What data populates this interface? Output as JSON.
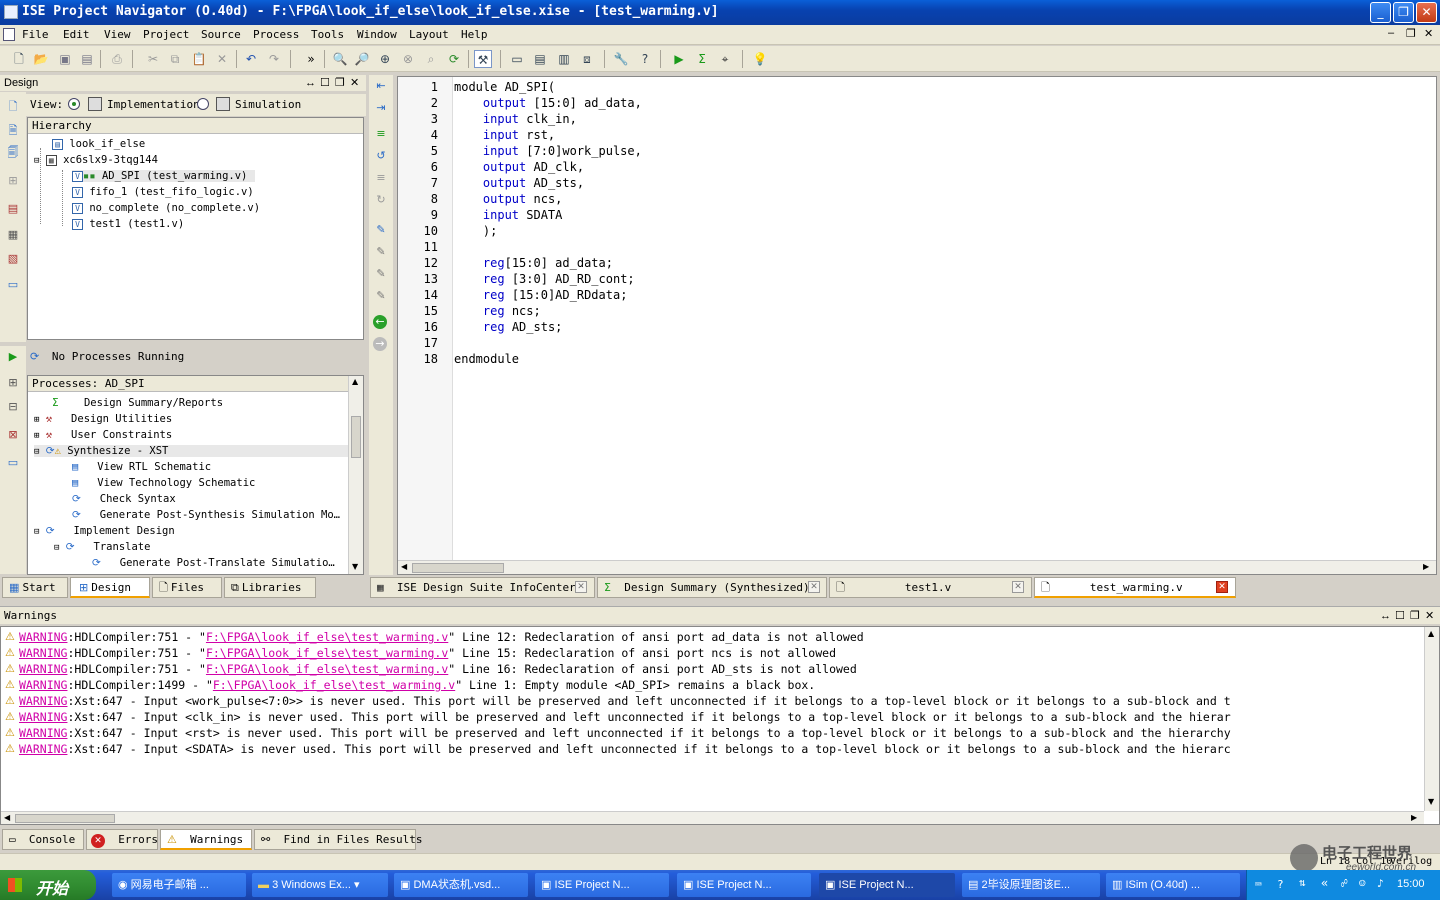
{
  "window": {
    "title": "ISE Project Navigator (O.40d) - F:\\FPGA\\look_if_else\\look_if_else.xise - [test_warming.v]"
  },
  "menu": [
    "File",
    "Edit",
    "View",
    "Project",
    "Source",
    "Process",
    "Tools",
    "Window",
    "Layout",
    "Help"
  ],
  "design_panel": {
    "title": "Design",
    "view_label": "View:",
    "impl_label": "Implementation",
    "sim_label": "Simulation",
    "hierarchy_header": "Hierarchy",
    "tree": [
      "look_if_else",
      "xc6slx9-3tqg144",
      "AD_SPI (test_warming.v)",
      "fifo_1 (test_fifo_logic.v)",
      "no_complete (no_complete.v)",
      "test1 (test1.v)"
    ],
    "status": "No Processes Running",
    "processes_header": "Processes: AD_SPI",
    "processes": [
      "Design Summary/Reports",
      "Design Utilities",
      "User Constraints",
      "Synthesize - XST",
      "View RTL Schematic",
      "View Technology Schematic",
      "Check Syntax",
      "Generate Post-Synthesis Simulation Mo…",
      "Implement Design",
      "Translate",
      "Generate Post-Translate Simulatio…"
    ],
    "bottom_tabs": [
      "Start",
      "Design",
      "Files",
      "Libraries"
    ]
  },
  "editor": {
    "lines": [
      {
        "n": "1",
        "pre": "module AD_SPI(",
        "kw": "",
        "post": ""
      },
      {
        "n": "2",
        "pre": "    ",
        "kw": "output",
        "post": " [15:0] ad_data,"
      },
      {
        "n": "3",
        "pre": "    ",
        "kw": "input",
        "post": " clk_in,"
      },
      {
        "n": "4",
        "pre": "    ",
        "kw": "input",
        "post": " rst,"
      },
      {
        "n": "5",
        "pre": "    ",
        "kw": "input",
        "post": " [7:0]work_pulse,"
      },
      {
        "n": "6",
        "pre": "    ",
        "kw": "output",
        "post": " AD_clk,"
      },
      {
        "n": "7",
        "pre": "    ",
        "kw": "output",
        "post": " AD_sts,"
      },
      {
        "n": "8",
        "pre": "    ",
        "kw": "output",
        "post": " ncs,"
      },
      {
        "n": "9",
        "pre": "    ",
        "kw": "input",
        "post": " SDATA"
      },
      {
        "n": "10",
        "pre": "    );",
        "kw": "",
        "post": ""
      },
      {
        "n": "11",
        "pre": "",
        "kw": "",
        "post": ""
      },
      {
        "n": "12",
        "pre": "    ",
        "kw": "reg",
        "post": "[15:0] ad_data;"
      },
      {
        "n": "13",
        "pre": "    ",
        "kw": "reg",
        "post": " [3:0] AD_RD_cont;"
      },
      {
        "n": "14",
        "pre": "    ",
        "kw": "reg",
        "post": " [15:0]AD_RDdata;"
      },
      {
        "n": "15",
        "pre": "    ",
        "kw": "reg",
        "post": " ncs;"
      },
      {
        "n": "16",
        "pre": "    ",
        "kw": "reg",
        "post": " AD_sts;"
      },
      {
        "n": "17",
        "pre": "",
        "kw": "",
        "post": ""
      },
      {
        "n": "18",
        "pre": "endmodule",
        "kw": "",
        "post": ""
      }
    ],
    "tabs": [
      "ISE Design Suite InfoCenter",
      "Design Summary (Synthesized)",
      "test1.v",
      "test_warming.v"
    ]
  },
  "warnings_panel": {
    "title": "Warnings",
    "lines": [
      {
        "tag": "WARNING",
        "a": ":HDLCompiler:751 - \"",
        "link": "F:\\FPGA\\look_if_else\\test_warming.v",
        "b": "\" Line 12: Redeclaration of ansi port ad_data is not allowed"
      },
      {
        "tag": "WARNING",
        "a": ":HDLCompiler:751 - \"",
        "link": "F:\\FPGA\\look_if_else\\test_warming.v",
        "b": "\" Line 15: Redeclaration of ansi port ncs is not allowed"
      },
      {
        "tag": "WARNING",
        "a": ":HDLCompiler:751 - \"",
        "link": "F:\\FPGA\\look_if_else\\test_warming.v",
        "b": "\" Line 16: Redeclaration of ansi port AD_sts is not allowed"
      },
      {
        "tag": "WARNING",
        "a": ":HDLCompiler:1499 - \"",
        "link": "F:\\FPGA\\look_if_else\\test_warming.v",
        "b": "\" Line 1: Empty module <AD_SPI> remains a black box."
      },
      {
        "tag": "WARNING",
        "a": ":Xst:647 - Input <work_pulse<7:0>> is never used. This port will be preserved and left unconnected if it belongs to a top-level block or it belongs to a sub-block and t",
        "link": "",
        "b": ""
      },
      {
        "tag": "WARNING",
        "a": ":Xst:647 - Input <clk_in> is never used. This port will be preserved and left unconnected if it belongs to a top-level block or it belongs to a sub-block and the hierar",
        "link": "",
        "b": ""
      },
      {
        "tag": "WARNING",
        "a": ":Xst:647 - Input <rst> is never used. This port will be preserved and left unconnected if it belongs to a top-level block or it belongs to a sub-block and the hierarchy",
        "link": "",
        "b": ""
      },
      {
        "tag": "WARNING",
        "a": ":Xst:647 - Input <SDATA> is never used. This port will be preserved and left unconnected if it belongs to a top-level block or it belongs to a sub-block and the hierarc",
        "link": "",
        "b": ""
      }
    ],
    "bottom_tabs": [
      "Console",
      "Errors",
      "Warnings",
      "Find in Files Results"
    ]
  },
  "statusbar": {
    "position": "Ln 18 Col 10",
    "lang": "Verilog"
  },
  "watermark": {
    "line1": "电子工程世界",
    "line2": "eeworld.com.cn"
  },
  "taskbar": {
    "start": "开始",
    "items": [
      "网易电子邮箱 ...",
      "3 Windows Ex...",
      "DMA状态机.vsd...",
      "ISE Project N...",
      "ISE Project N...",
      "ISE Project N...",
      "2毕设原理图该E...",
      "ISim (O.40d) ..."
    ],
    "clock": "15:00"
  }
}
